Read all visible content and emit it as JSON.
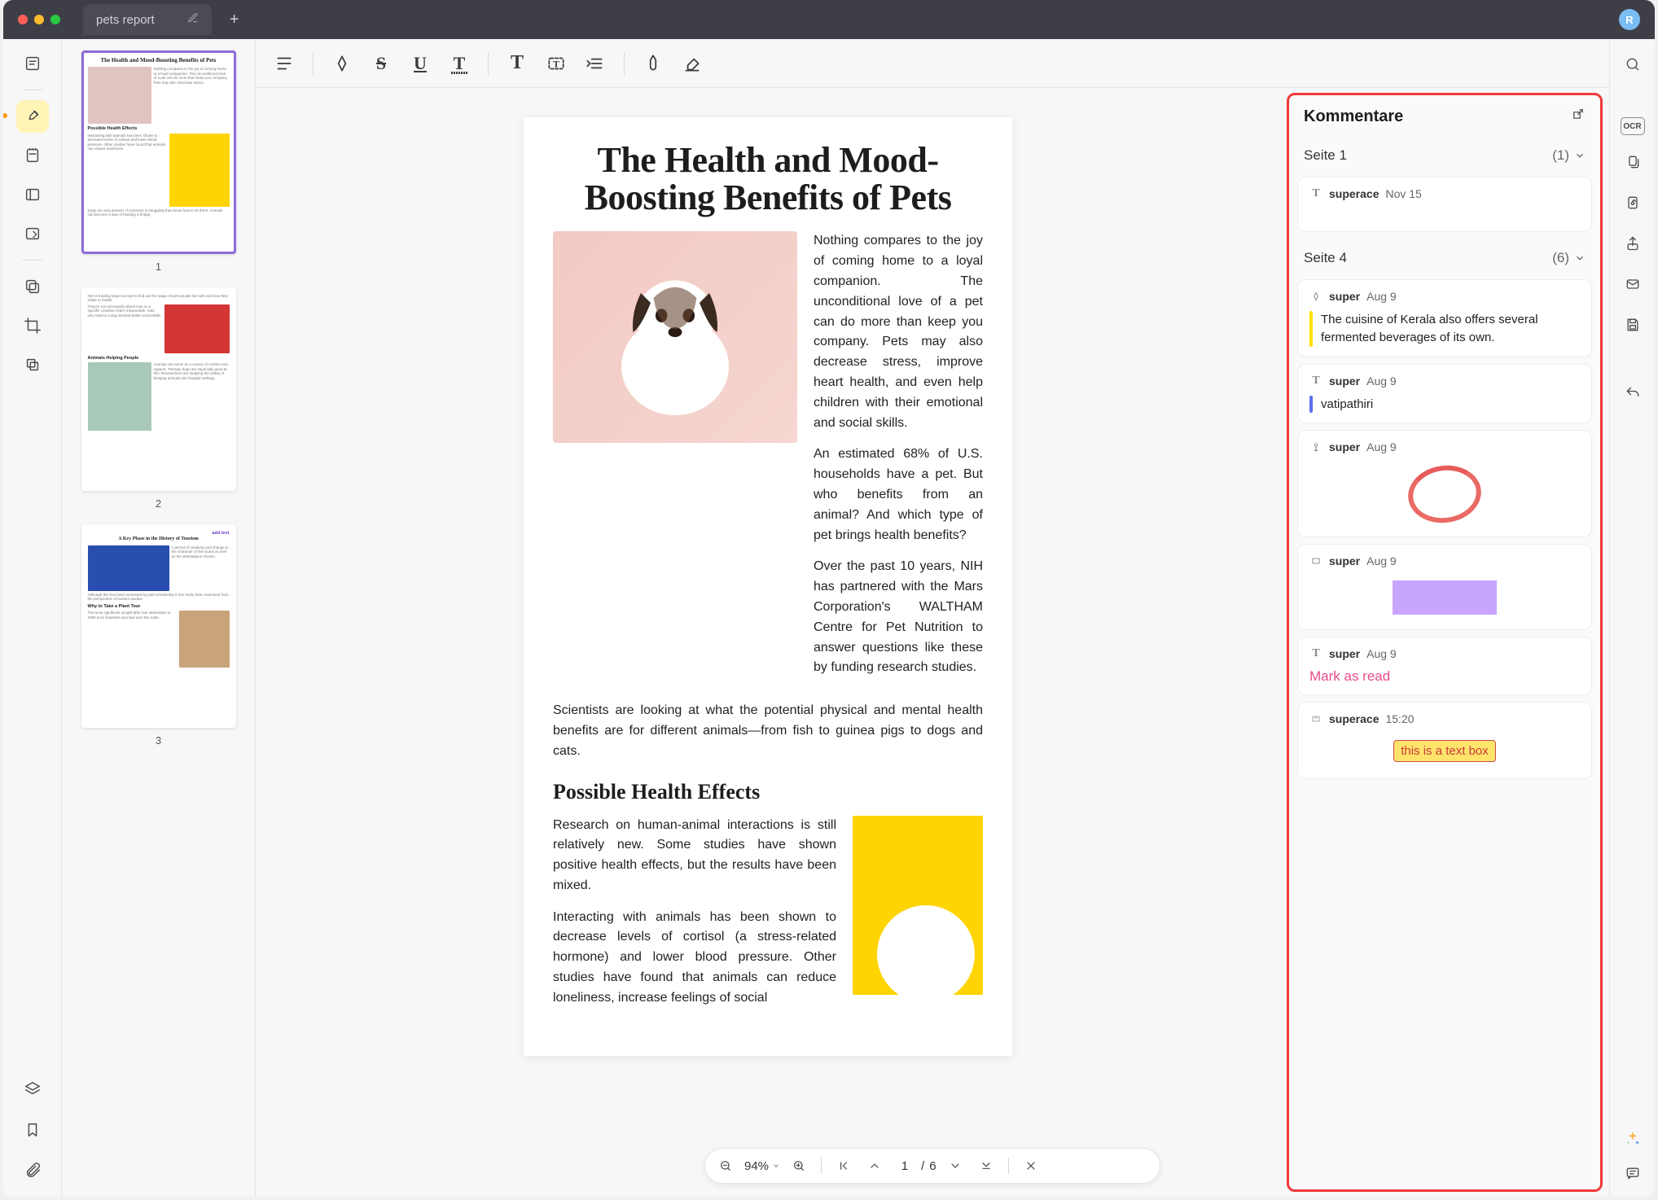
{
  "titlebar": {
    "tab_title": "pets report",
    "avatar_initial": "R"
  },
  "rail": {
    "tools": [
      "reader",
      "highlighter-active",
      "note",
      "panel",
      "edit",
      "copy",
      "crop",
      "stack"
    ],
    "bottom": [
      "layers",
      "bookmark",
      "attachment"
    ]
  },
  "toolbar": {
    "buttons": [
      "paragraph",
      "marker",
      "strike",
      "underline",
      "squiggle",
      "text",
      "textbox",
      "list-indent",
      "pen",
      "eraser"
    ]
  },
  "rrail": {
    "search": true,
    "ocr_label": "OCR",
    "items": [
      "ocr",
      "duplicate",
      "lock",
      "share",
      "mail",
      "save"
    ],
    "undo": true,
    "bottom": [
      "sparkle",
      "comment"
    ]
  },
  "thumbnails": [
    {
      "num": "1",
      "title": "The Health and Mood-Boosting Benefits of Pets",
      "selected": true
    },
    {
      "num": "2",
      "title": "Animals Helping People",
      "selected": false
    },
    {
      "num": "3",
      "title": "A Key Phase in the History of Tourism",
      "subtitle": "add text",
      "why": "Why to Take a Plant Tour",
      "selected": false
    }
  ],
  "document": {
    "title": "The Health and Mood-Boosting Benefits of Pets",
    "p1": "Nothing compares to the joy of coming home to a loyal companion. The unconditional love of a pet can do more than keep you company. Pets may also decrease stress, improve heart health, and even help children with their emotional and social skills.",
    "p2": "An estimated 68% of U.S. households have a pet. But who benefits from an animal? And which type of pet brings health benefits?",
    "p3": "Over the past 10 years, NIH has partnered with the Mars Corporation's WALTHAM Centre for Pet Nutrition to answer questions like these by funding research studies.",
    "p4": "Scientists are looking at what the potential physical and mental health benefits are for different animals—from fish to guinea pigs to dogs and cats.",
    "h2": "Possible Health Effects",
    "p5": "Research on human-animal interactions is still relatively new. Some studies have shown positive health effects, but the results have been mixed.",
    "p6": "Interacting with animals has been shown to decrease levels of cortisol (a stress-related hormone) and lower blood pressure. Other studies have found that animals can reduce loneliness, increase feelings of social"
  },
  "zoombar": {
    "zoom": "94%",
    "page_current": "1",
    "page_sep": "/",
    "page_total": "6"
  },
  "comments": {
    "title": "Kommentare",
    "groups": [
      {
        "page": "Seite 1",
        "count": "(1)",
        "items": [
          {
            "type": "text",
            "user": "superace",
            "date": "Nov 15",
            "body": ""
          }
        ]
      },
      {
        "page": "Seite 4",
        "count": "(6)",
        "items": [
          {
            "type": "highlight",
            "user": "super",
            "date": "Aug 9",
            "bar": "yellow",
            "body": "The cuisine of Kerala also offers several fermented beverages of its own."
          },
          {
            "type": "text",
            "user": "super",
            "date": "Aug 9",
            "bar": "blue",
            "body": "vatipathiri"
          },
          {
            "type": "ink",
            "user": "super",
            "date": "Aug 9"
          },
          {
            "type": "rect",
            "user": "super",
            "date": "Aug 9"
          },
          {
            "type": "text",
            "user": "super",
            "date": "Aug 9",
            "pink": "Mark as read"
          },
          {
            "type": "textbox",
            "user": "superace",
            "date": "15:20",
            "textbox": "this is a text box"
          }
        ]
      }
    ]
  }
}
